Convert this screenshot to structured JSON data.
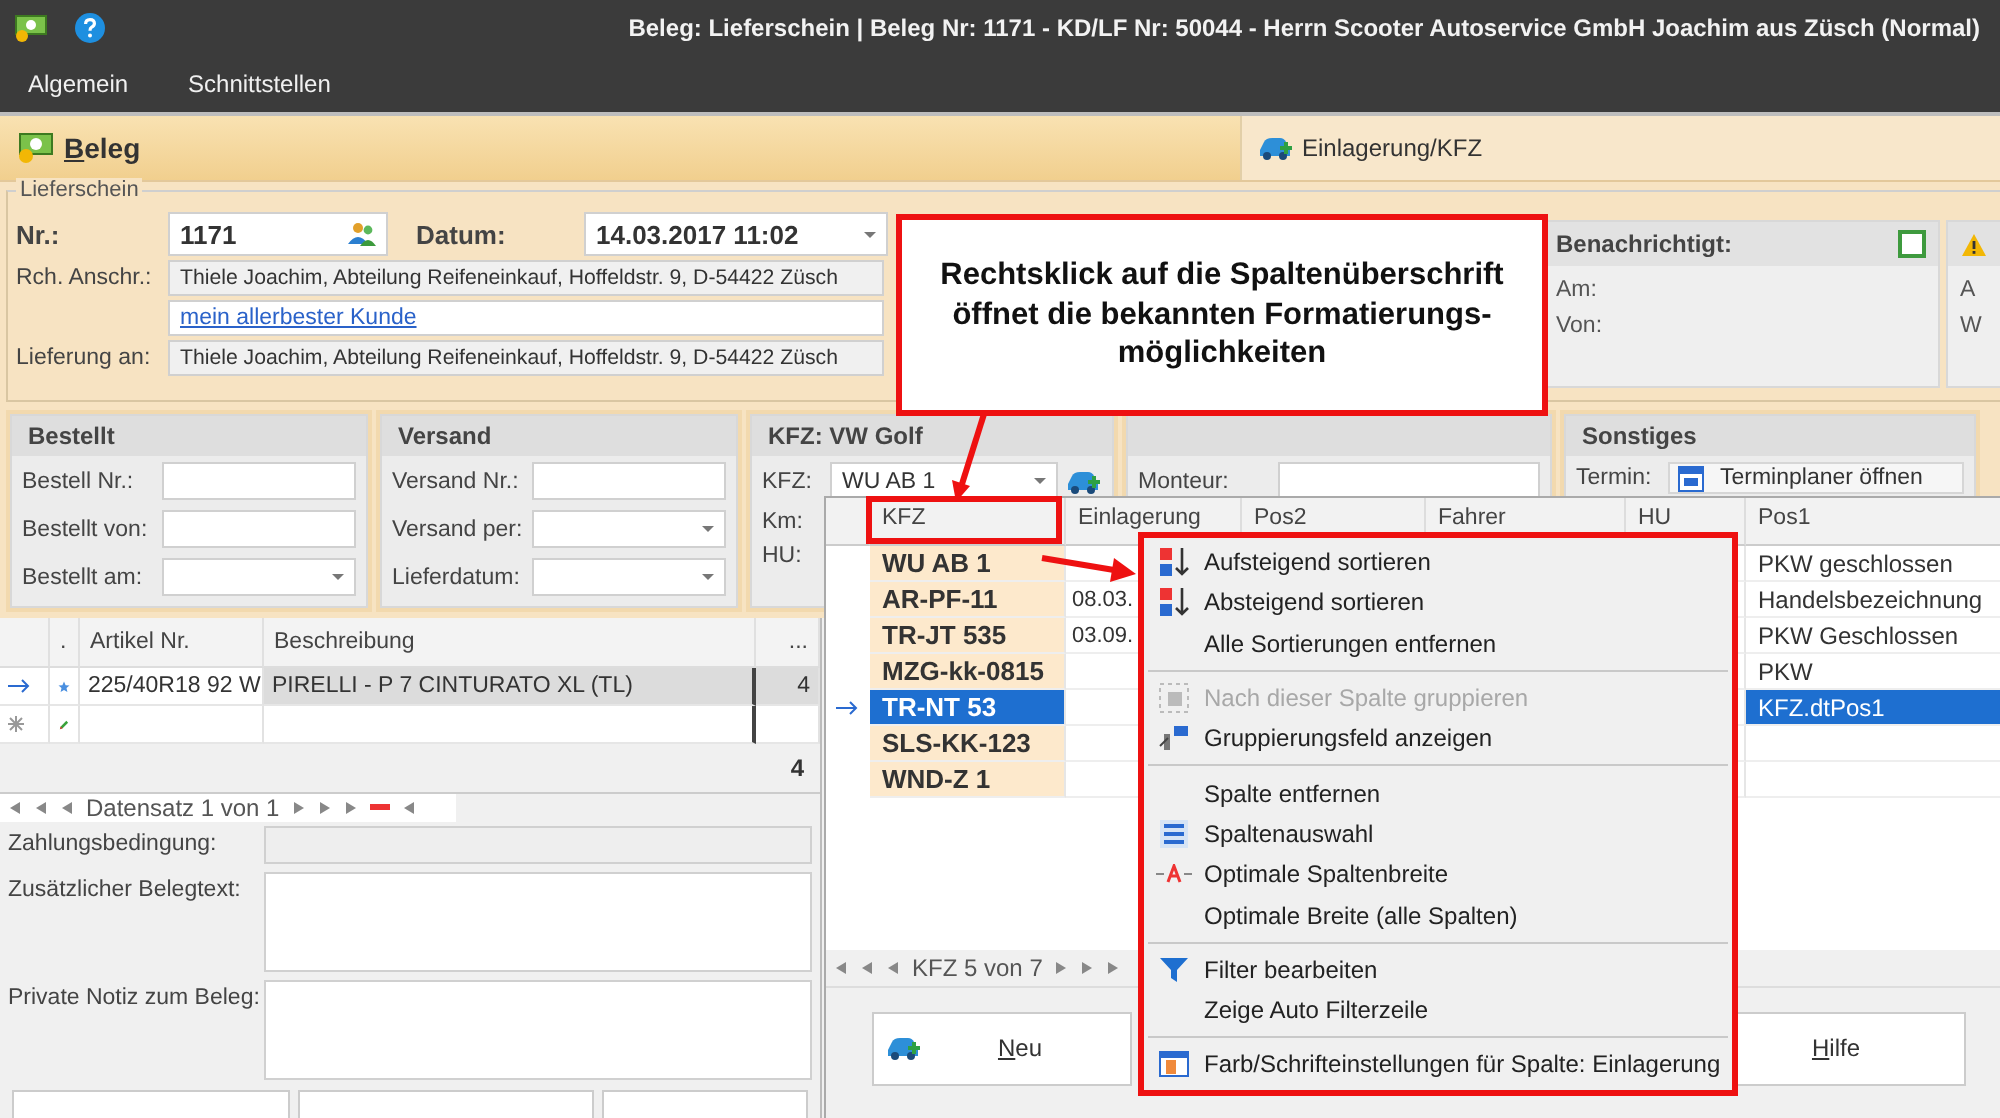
{
  "window": {
    "title": "Beleg: Lieferschein | Beleg Nr: 1171  -  KD/LF Nr: 50044 - Herrn Scooter Autoservice GmbH Joachim aus Züsch (Normal)"
  },
  "menu": [
    {
      "label": "Algemein"
    },
    {
      "label": "Schnittstellen"
    }
  ],
  "tabs": [
    {
      "label": "Beleg",
      "selected": true
    },
    {
      "label": "Einlagerung/KFZ",
      "selected": false
    }
  ],
  "lieferschein": {
    "title": "Lieferschein",
    "nr_label": "Nr.:",
    "nr": "1171",
    "datum_label": "Datum:",
    "datum": "14.03.2017 11:02",
    "rch_label": "Rch. Anschr.:",
    "rch": "Thiele Joachim, Abteilung Reifeneinkauf, Hoffeldstr. 9,  D-54422 Züsch",
    "link": "mein allerbester Kunde",
    "lieferung_label": "Lieferung an:",
    "lieferung": "Thiele Joachim, Abteilung Reifeneinkauf, Hoffeldstr. 9,  D-54422 Züsch"
  },
  "benachrichtigt": {
    "title": "Benachrichtigt:",
    "checked": false,
    "fields": [
      "Am:",
      "Von:"
    ]
  },
  "warning_panel": {
    "fields": [
      "A",
      "W"
    ]
  },
  "groups": [
    {
      "title": "Bestellt",
      "fields": [
        {
          "label": "Bestell Nr.:",
          "kind": "text"
        },
        {
          "label": "Bestellt von:",
          "kind": "text"
        },
        {
          "label": "Bestellt am:",
          "kind": "dropdown"
        }
      ]
    },
    {
      "title": "Versand",
      "fields": [
        {
          "label": "Versand Nr.:",
          "kind": "text"
        },
        {
          "label": "Versand per:",
          "kind": "dropdown"
        },
        {
          "label": "Lieferdatum:",
          "kind": "dropdown"
        }
      ]
    },
    {
      "title": "KFZ:  VW Golf",
      "fields": [
        {
          "label": "KFZ:",
          "kind": "combo",
          "value": "WU AB 1"
        },
        {
          "label": "Km:",
          "kind": "text"
        },
        {
          "label": "HU:",
          "kind": "text"
        }
      ]
    },
    {
      "fields": [
        {
          "label": "Monteur:",
          "kind": "text"
        }
      ]
    },
    {
      "title": "Sonstiges",
      "fields": [
        {
          "label": "Termin:",
          "kind": "button",
          "value": "Terminplaner öffnen"
        }
      ]
    }
  ],
  "articles": {
    "columns": [
      ".",
      "Artikel Nr.",
      "Beschreibung",
      "..."
    ],
    "rows": [
      {
        "artikel": "225/40R18 92 W",
        "beschreibung": "PIRELLI - P 7 CINTURATO XL (TL)",
        "menge": "4",
        "selected": true
      }
    ],
    "total": "4",
    "navigator": "Datensatz 1 von 1"
  },
  "notes": [
    {
      "label": "Zahlungsbedingung:",
      "kind": "line"
    },
    {
      "label": "Zusätzlicher Belegtext:",
      "kind": "area"
    },
    {
      "label": "Private Notiz zum Beleg:",
      "kind": "area"
    }
  ],
  "kfz_popup": {
    "columns": [
      "KFZ",
      "Einlagerung",
      "Pos2",
      "Fahrer",
      "HU",
      "Pos1"
    ],
    "rows": [
      {
        "kfz": "WU AB 1",
        "einlagerung": "",
        "pos1": "PKW geschlossen",
        "selected": false
      },
      {
        "kfz": "AR-PF-11",
        "einlagerung": "08.03.",
        "pos1": "Handelsbezeichnung",
        "selected": false
      },
      {
        "kfz": "TR-JT 535",
        "einlagerung": "03.09.",
        "pos1": "PKW Geschlossen",
        "selected": false
      },
      {
        "kfz": "MZG-kk-0815",
        "einlagerung": "",
        "pos1": "PKW",
        "selected": false
      },
      {
        "kfz": "TR-NT 53",
        "einlagerung": "",
        "pos1": "KFZ.dtPos1",
        "selected": true
      },
      {
        "kfz": "SLS-KK-123",
        "einlagerung": "",
        "pos1": "",
        "selected": false
      },
      {
        "kfz": "WND-Z 1",
        "einlagerung": "",
        "pos1": "",
        "selected": false
      }
    ],
    "navigator": "KFZ 5 von 7",
    "buttons": [
      "Neu",
      "Hilfe"
    ]
  },
  "context_menu": {
    "groups": [
      [
        {
          "label": "Aufsteigend sortieren",
          "kind": "sort-asc",
          "disabled": false
        },
        {
          "label": "Absteigend sortieren",
          "kind": "sort-desc",
          "disabled": false
        },
        {
          "label": "Alle Sortierungen entfernen",
          "kind": "plain",
          "disabled": false
        }
      ],
      [
        {
          "label": "Nach dieser Spalte gruppieren",
          "kind": "group",
          "disabled": true
        },
        {
          "label": "Gruppierungsfeld anzeigen",
          "kind": "group-panel",
          "disabled": false
        }
      ],
      [
        {
          "label": "Spalte entfernen",
          "kind": "plain",
          "disabled": false
        },
        {
          "label": "Spaltenauswahl",
          "kind": "columns",
          "disabled": false
        },
        {
          "label": "Optimale Spaltenbreite",
          "kind": "best-fit",
          "disabled": false
        },
        {
          "label": "Optimale Breite (alle Spalten)",
          "kind": "plain",
          "disabled": false
        }
      ],
      [
        {
          "label": "Filter bearbeiten",
          "kind": "filter",
          "disabled": false
        },
        {
          "label": "Zeige Auto Filterzeile",
          "kind": "plain",
          "disabled": false
        }
      ],
      [
        {
          "label": "Farb/Schrifteinstellungen für Spalte: Einlagerung",
          "kind": "format",
          "disabled": false
        }
      ]
    ]
  },
  "callout": {
    "text": "Rechtsklick auf die Spaltenüberschrift öffnet die bekannten Formatierungs-möglichkeiten"
  }
}
